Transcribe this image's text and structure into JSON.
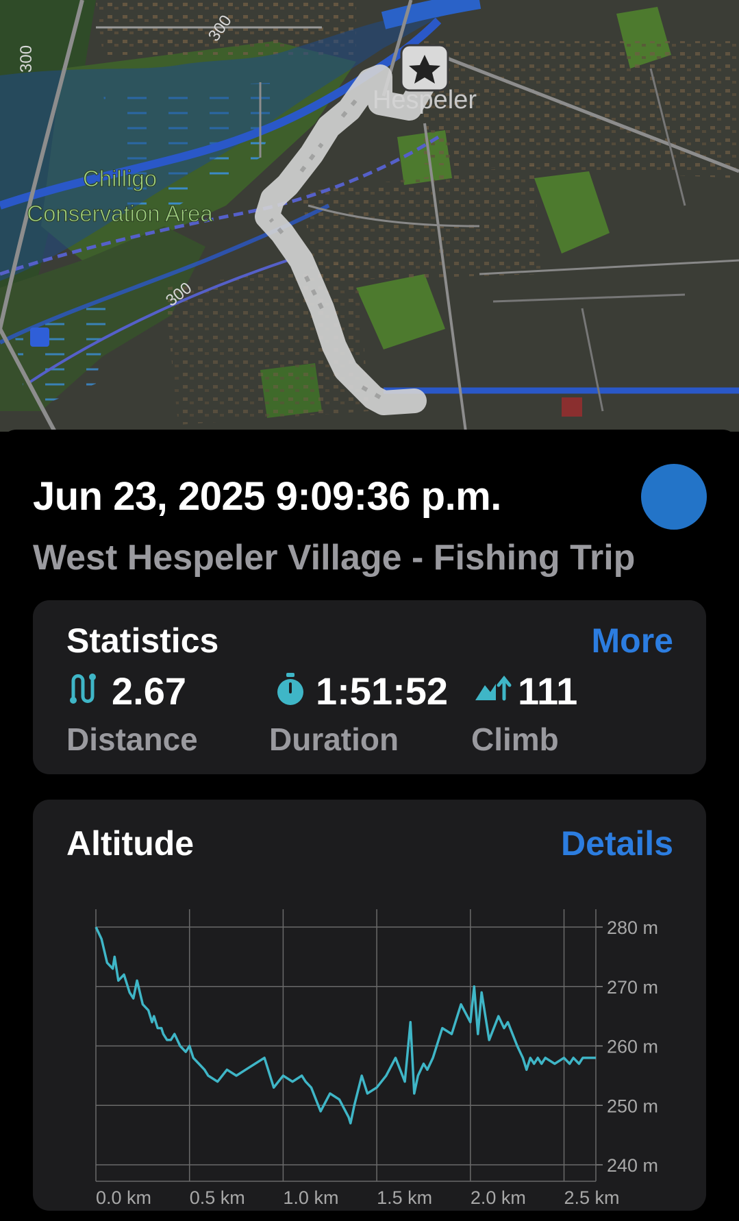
{
  "map": {
    "labels": {
      "park_line1": "Chilligo",
      "park_line2": "Conservation Area",
      "town": "Hespeler",
      "road_number_1": "300",
      "road_number_2": "300",
      "road_number_3": "300"
    },
    "favorite_icon": "star-icon",
    "colors": {
      "route": "#d4d4d4",
      "river": "#2a58c8",
      "park": "#4d7a2e"
    }
  },
  "track": {
    "datetime": "Jun 23, 2025 9:09:36 p.m.",
    "name": "West Hespeler Village - Fishing Trip",
    "color": "#2374c8"
  },
  "statistics": {
    "title": "Statistics",
    "more_label": "More",
    "distance": {
      "value": "2.67",
      "label": "Distance",
      "icon": "route-icon"
    },
    "duration": {
      "value": "1:51:52",
      "label": "Duration",
      "icon": "stopwatch-icon"
    },
    "climb": {
      "value": "111",
      "label": "Climb",
      "icon": "climb-icon"
    }
  },
  "altitude": {
    "title": "Altitude",
    "details_label": "Details"
  },
  "chart_data": {
    "type": "line",
    "title": "Altitude",
    "x_tick_labels": [
      "0.0 km",
      "0.5 km",
      "1.0 km",
      "1.5 km",
      "2.0 km",
      "2.5 km"
    ],
    "y_tick_labels": [
      "280 m",
      "270 m",
      "260 m",
      "250 m",
      "240 m"
    ],
    "xlim": [
      0,
      2.67
    ],
    "ylim": [
      240,
      281
    ],
    "y_ticks": [
      280,
      270,
      260,
      250,
      240
    ],
    "x_ticks": [
      0,
      0.5,
      1.0,
      1.5,
      2.0,
      2.5
    ],
    "grid": true,
    "series": [
      {
        "color": "#3fb6c7",
        "x": [
          0,
          0.03,
          0.06,
          0.09,
          0.1,
          0.12,
          0.15,
          0.18,
          0.2,
          0.22,
          0.25,
          0.28,
          0.3,
          0.31,
          0.33,
          0.35,
          0.36,
          0.38,
          0.4,
          0.42,
          0.45,
          0.48,
          0.5,
          0.52,
          0.55,
          0.58,
          0.6,
          0.65,
          0.7,
          0.75,
          0.8,
          0.85,
          0.9,
          0.95,
          1.0,
          1.05,
          1.1,
          1.12,
          1.15,
          1.2,
          1.25,
          1.3,
          1.35,
          1.36,
          1.38,
          1.42,
          1.45,
          1.5,
          1.55,
          1.6,
          1.65,
          1.68,
          1.7,
          1.72,
          1.75,
          1.77,
          1.8,
          1.85,
          1.9,
          1.95,
          2.0,
          2.02,
          2.04,
          2.06,
          2.1,
          2.15,
          2.18,
          2.2,
          2.25,
          2.28,
          2.3,
          2.32,
          2.34,
          2.36,
          2.38,
          2.4,
          2.45,
          2.5,
          2.53,
          2.55,
          2.58,
          2.6,
          2.63,
          2.67
        ],
        "y": [
          280,
          278,
          274,
          273,
          275,
          271,
          272,
          269,
          268,
          271,
          267,
          266,
          264,
          265,
          263,
          263,
          262,
          261,
          261,
          262,
          260,
          259,
          260,
          258,
          257,
          256,
          255,
          254,
          256,
          255,
          256,
          257,
          258,
          253,
          255,
          254,
          255,
          254,
          253,
          249,
          252,
          251,
          248,
          247,
          250,
          255,
          252,
          253,
          255,
          258,
          254,
          264,
          252,
          255,
          257,
          256,
          258,
          263,
          262,
          267,
          264,
          270,
          262,
          269,
          261,
          265,
          263,
          264,
          260,
          258,
          256,
          258,
          257,
          258,
          257,
          258,
          257,
          258,
          257,
          258,
          257,
          258,
          258,
          258
        ]
      }
    ]
  }
}
